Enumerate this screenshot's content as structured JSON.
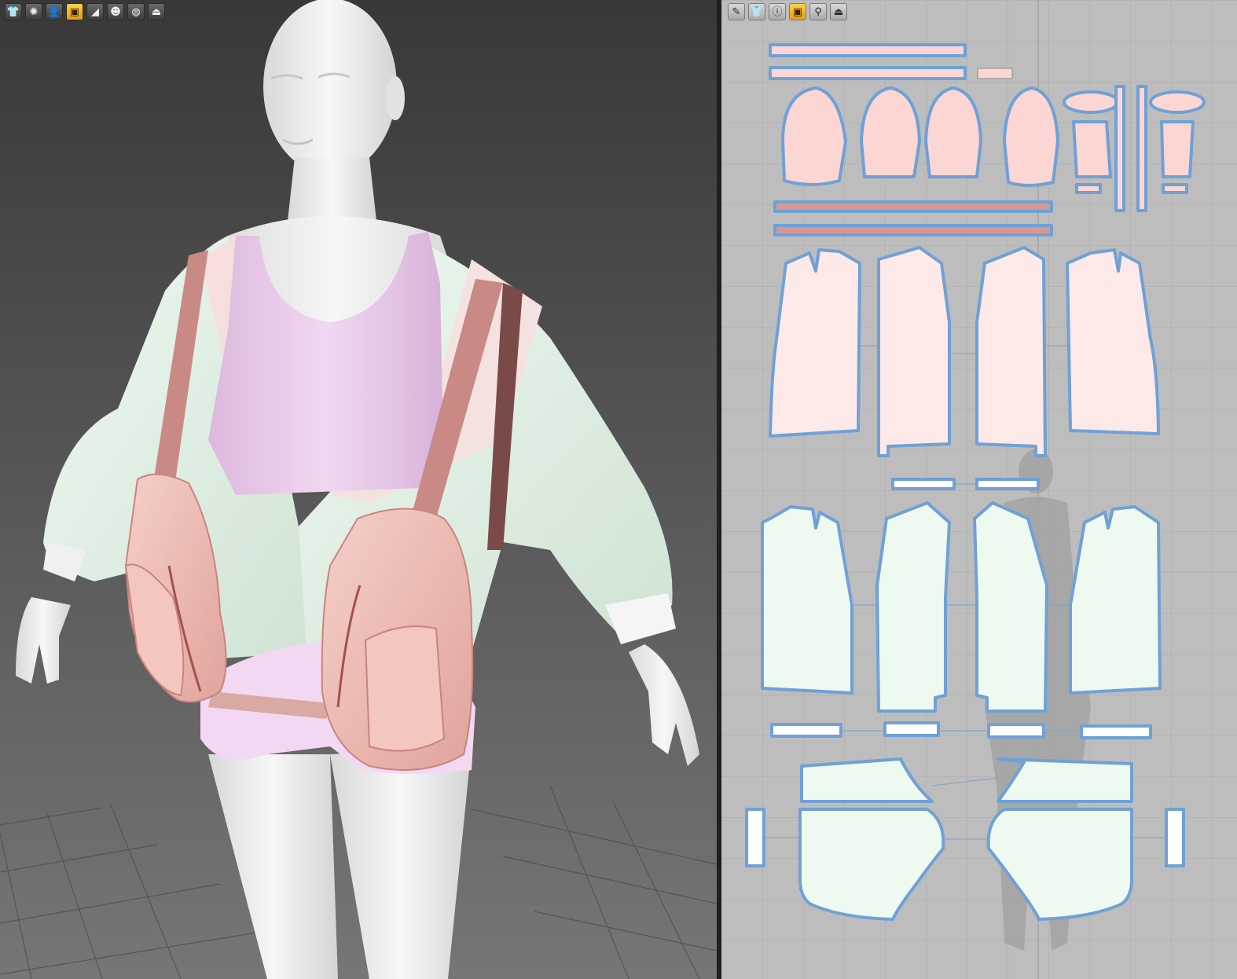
{
  "colors": {
    "background_3d_top": "#3a3a3a",
    "background_3d_bottom": "#6e6e6e",
    "avatar": "#ececec",
    "jacket": "#e6f2e8",
    "lining": "#f6dede",
    "tank_top": "#e9ccea",
    "shorts": "#f2d8f2",
    "vest": "#f0bcb6",
    "strap": "#c98a86",
    "pattern_bg": "#bdbdbd",
    "pattern_outline": "#6fa1d6",
    "pink_piece": "#fbd6d3",
    "pink_piece_light": "#fde9e8",
    "green_piece": "#eef9ef",
    "accent_active": "#f5a623"
  },
  "toolbar_3d": [
    {
      "icon": "garment-icon",
      "glyph": "👕",
      "active": false
    },
    {
      "icon": "simulation-icon",
      "glyph": "✺",
      "active": false
    },
    {
      "icon": "avatar-icon",
      "glyph": "👤",
      "active": false
    },
    {
      "icon": "texture-icon",
      "glyph": "▣",
      "active": true
    },
    {
      "icon": "thickness-icon",
      "glyph": "◢",
      "active": false
    },
    {
      "icon": "skin-icon",
      "glyph": "☻",
      "active": false
    },
    {
      "icon": "globe-icon",
      "glyph": "◍",
      "active": false
    },
    {
      "icon": "export-icon",
      "glyph": "⏏",
      "active": false
    }
  ],
  "toolbar_2d": [
    {
      "icon": "brush-icon",
      "glyph": "✎",
      "active": false
    },
    {
      "icon": "garment-icon",
      "glyph": "👕",
      "active": false
    },
    {
      "icon": "info-icon",
      "glyph": "ⓘ",
      "active": false
    },
    {
      "icon": "texture-icon",
      "glyph": "▣",
      "active": true
    },
    {
      "icon": "fitting-icon",
      "glyph": "⚲",
      "active": false
    },
    {
      "icon": "export-icon",
      "glyph": "⏏",
      "active": false
    }
  ]
}
